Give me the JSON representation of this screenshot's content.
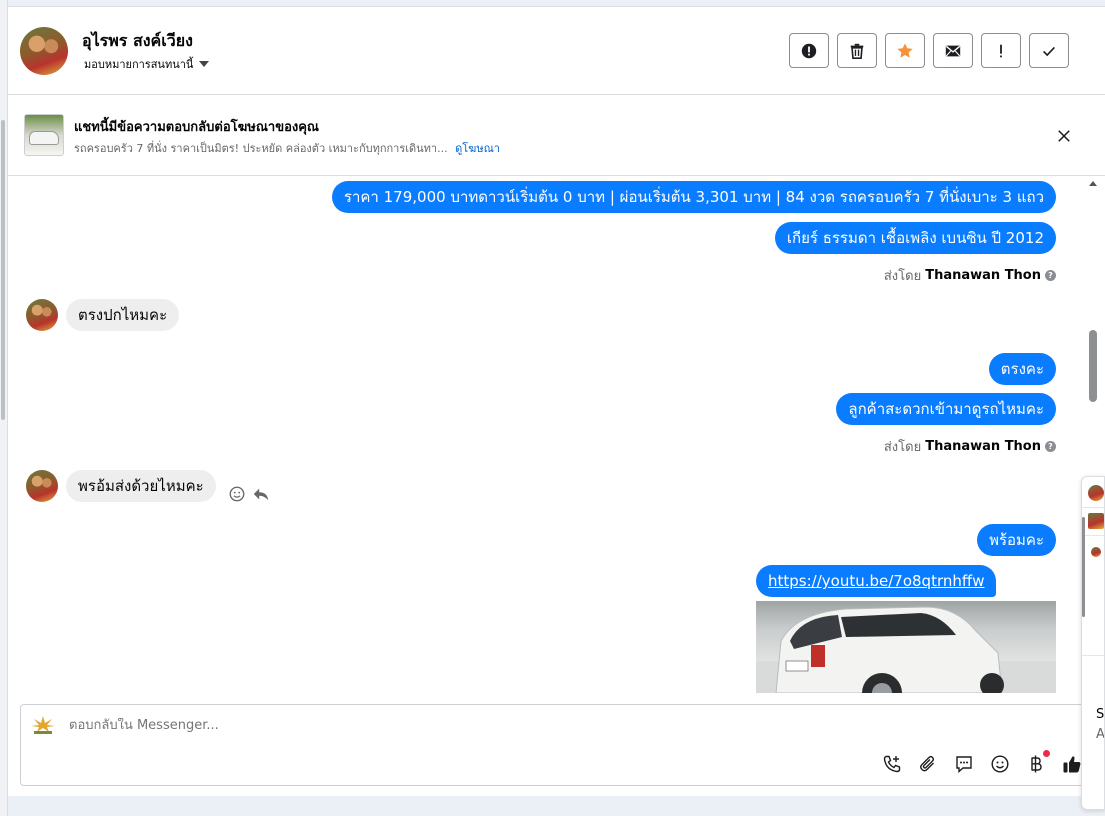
{
  "header": {
    "user_name": "อุไรพร สงค์เวียง",
    "assign_label": "มอบหมายการสนทนานี้",
    "buttons": [
      {
        "name": "spam-alert-button",
        "icon": "alert-circle-icon"
      },
      {
        "name": "delete-button",
        "icon": "trash-icon"
      },
      {
        "name": "star-button",
        "icon": "star-icon"
      },
      {
        "name": "mark-unread-button",
        "icon": "envelope-icon"
      },
      {
        "name": "important-button",
        "icon": "exclamation-icon"
      },
      {
        "name": "mark-done-button",
        "icon": "check-icon"
      }
    ]
  },
  "ad_banner": {
    "title": "แชทนี้มีข้อความตอบกลับต่อโฆษณาของคุณ",
    "description": "รถครอบครัว 7 ที่นั่ง ราคาเป็นมิตร! ประหยัด คล่องตัว เหมาะกับทุกการเดินทา...",
    "link_label": "ดูโฆษณา"
  },
  "messages": {
    "out1_line1": "ราคา 179,000 บาทดาวน์เริ่มต้น 0 บาท | ผ่อนเริ่มต้น 3,301 บาท | 84 งวด รถครอบครัว 7 ที่นั่งเบาะ 3 แถว",
    "out1_line2": "เกียร์ ธรรมดา เชื้อเพลิง เบนซิน ปี 2012",
    "sent_by_prefix": "ส่งโดย",
    "sent_by_name": "Thanawan Thon",
    "in1": "ตรงปกไหมคะ",
    "out2_line1": "ตรงคะ",
    "out2_line2": "ลูกค้าสะดวกเข้ามาดูรถไหมคะ",
    "in2": "พรอ้มส่งด้วยไหมคะ",
    "out3_line1": "พร้อมคะ",
    "out3_link": "https://youtu.be/7o8qtrnhffw"
  },
  "composer": {
    "placeholder": "ตอบกลับใน Messenger...",
    "tools": [
      "phone-plus-icon",
      "paperclip-icon",
      "saved-reply-icon",
      "emoji-icon",
      "baht-payment-icon",
      "thumbs-up-icon"
    ]
  },
  "float_panel": {
    "letter_s": "S",
    "letter_a": "A"
  },
  "colors": {
    "outgoing_bubble": "#0a7cff",
    "incoming_bubble": "#eeeeee",
    "star": "#f7923a",
    "link": "#0064d1"
  }
}
